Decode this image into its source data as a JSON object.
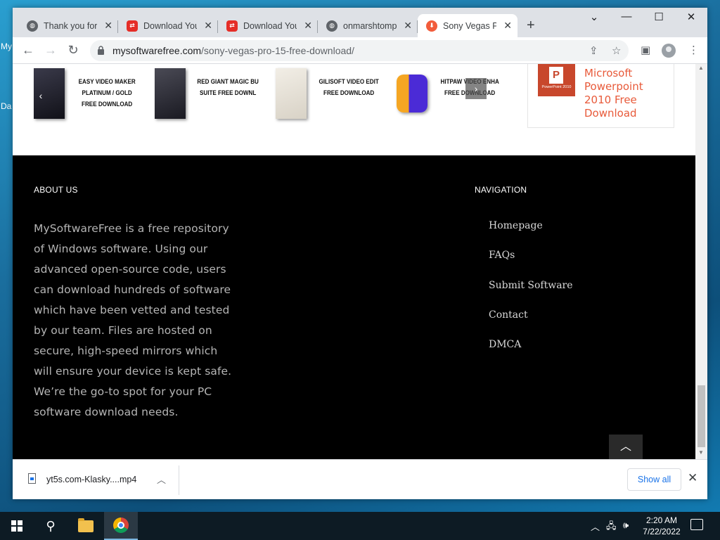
{
  "desktop": {
    "edge_text_1": "My",
    "edge_text_2": "Da"
  },
  "tabs": [
    {
      "title": "Thank you for d",
      "favicon": "globe-icon"
    },
    {
      "title": "Download You",
      "favicon": "youtube-downloader-icon"
    },
    {
      "title": "Download You",
      "favicon": "youtube-downloader-icon"
    },
    {
      "title": "onmarshtompe",
      "favicon": "globe-icon"
    },
    {
      "title": "Sony Vegas Pr",
      "favicon": "download-site-icon",
      "active": true
    }
  ],
  "window_controls": {
    "dropdown": "⌄",
    "minimize": "—",
    "maximize": "☐",
    "close": "✕"
  },
  "address_bar": {
    "host": "mysoftwarefree.com",
    "path": "/sony-vegas-pro-15-free-download/"
  },
  "carousel": {
    "items": [
      {
        "title_line1": "EASY VIDEO MAKER",
        "title_line2": "PLATINUM / GOLD",
        "title_line3": "FREE DOWNLOAD",
        "box_color": "#1d1d2b"
      },
      {
        "title_line1": "RED GIANT MAGIC BU",
        "title_line2": "SUITE FREE DOWNL",
        "title_line3": "",
        "box_color": "#2a2a33"
      },
      {
        "title_line1": "GILISOFT VIDEO EDIT",
        "title_line2": "FREE DOWNLOAD",
        "title_line3": "",
        "box_color": "#e9e4dc"
      },
      {
        "title_line1": "HITPAW VIDEO ENHA",
        "title_line2": "FREE DOWNLOAD",
        "title_line3": "",
        "box_color": "#4b2bd6"
      }
    ]
  },
  "sidebar_card": {
    "title": "Microsoft Powerpoint 2010 Free Download",
    "icon_letter": "P",
    "icon_caption": "PowerPoint 2010"
  },
  "footer": {
    "about_heading": "ABOUT US",
    "about_text": "MySoftwareFree is a free repository of Windows software. Using our advanced open-source code, users can download hundreds of software which have been vetted and tested by our team. Files are hosted on secure, high-speed mirrors which will ensure your device is kept safe. We’re the go-to spot for your PC software download needs.",
    "nav_heading": "NAVIGATION",
    "nav_items": [
      "Homepage",
      "FAQs",
      "Submit Software",
      "Contact",
      "DMCA"
    ]
  },
  "download_bar": {
    "file_name": "yt5s.com-Klasky....mp4",
    "show_all": "Show all"
  },
  "taskbar": {
    "time": "2:20 AM",
    "date": "7/22/2022"
  },
  "colors": {
    "accent_link": "#e85a3a",
    "footer_bg": "#000000",
    "chrome_blue": "#1a73e8"
  }
}
